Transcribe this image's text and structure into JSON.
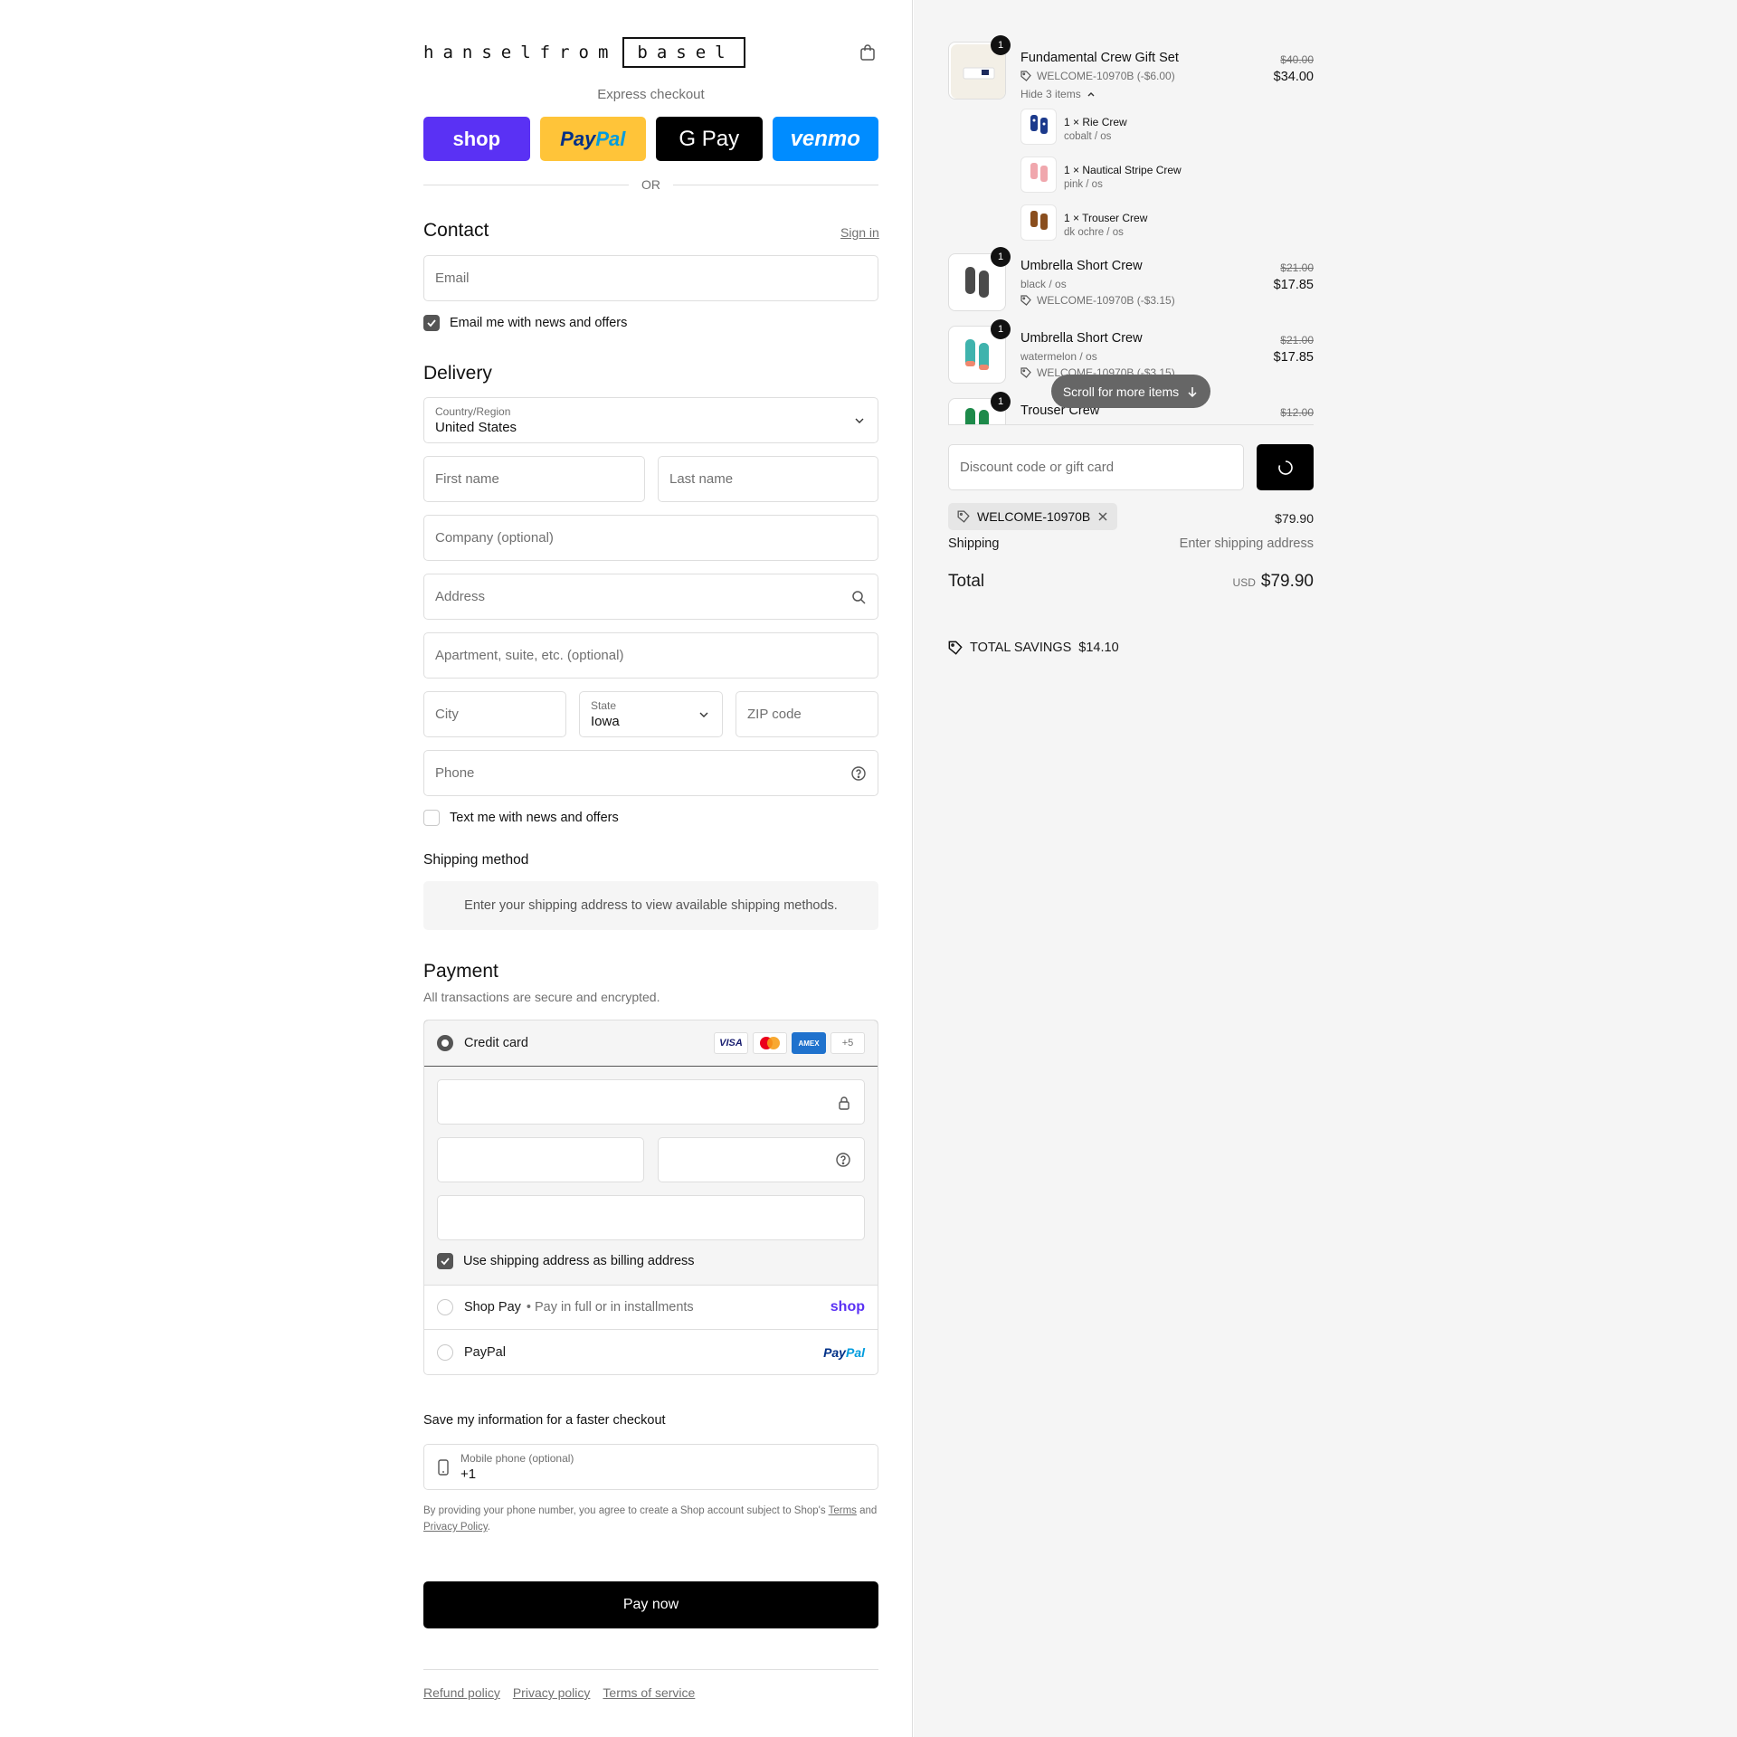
{
  "brand": {
    "left": "hanselfrom",
    "boxed": "basel"
  },
  "express": {
    "label": "Express checkout",
    "shop": "shop",
    "paypal_a": "Pay",
    "paypal_b": "Pal",
    "gpay": "G Pay",
    "venmo": "venmo",
    "or": "OR"
  },
  "contact": {
    "title": "Contact",
    "sign_in": "Sign in",
    "email_placeholder": "Email",
    "news_label": "Email me with news and offers"
  },
  "delivery": {
    "title": "Delivery",
    "country_label": "Country/Region",
    "country_value": "United States",
    "first_name": "First name",
    "last_name": "Last name",
    "company": "Company (optional)",
    "address": "Address",
    "apartment": "Apartment, suite, etc. (optional)",
    "city": "City",
    "state_label": "State",
    "state_value": "Iowa",
    "zip": "ZIP code",
    "phone": "Phone",
    "text_label": "Text me with news and offers"
  },
  "shipping_method": {
    "title": "Shipping method",
    "message": "Enter your shipping address to view available shipping methods."
  },
  "payment": {
    "title": "Payment",
    "subtitle": "All transactions are secure and encrypted.",
    "credit_card": "Credit card",
    "cards": [
      "VISA",
      "",
      "AMEX",
      "+5"
    ],
    "billing_label": "Use shipping address as billing address",
    "shop_pay": "Shop Pay",
    "shop_pay_sub": "• Pay in full or in installments",
    "shop_pay_brand": "shop",
    "paypal": "PayPal",
    "paypal_brand_a": "Pay",
    "paypal_brand_b": "Pal"
  },
  "save_info": {
    "title": "Save my information for a faster checkout",
    "mobile_label": "Mobile phone (optional)",
    "mobile_value": "+1",
    "legal_a": "By providing your phone number, you agree to create a Shop account subject to Shop's",
    "terms": "Terms",
    "legal_and": "and",
    "privacy": "Privacy Policy",
    "legal_end": "."
  },
  "pay_now": "Pay now",
  "footer": [
    "Refund policy",
    "Privacy policy",
    "Terms of service"
  ],
  "cart": {
    "items": [
      {
        "name": "Fundamental Crew Gift Set",
        "discount": "WELCOME-10970B (-$6.00)",
        "old_price": "$40.00",
        "price": "$34.00",
        "qty": "1",
        "toggle": "Hide 3 items",
        "sub_items": [
          {
            "qty_name": "1 × Rie Crew",
            "variant": "cobalt / os"
          },
          {
            "qty_name": "1 × Nautical Stripe Crew",
            "variant": "pink / os"
          },
          {
            "qty_name": "1 × Trouser Crew",
            "variant": "dk ochre / os"
          }
        ]
      },
      {
        "name": "Umbrella Short Crew",
        "variant": "black / os",
        "discount": "WELCOME-10970B (-$3.15)",
        "old_price": "$21.00",
        "price": "$17.85",
        "qty": "1"
      },
      {
        "name": "Umbrella Short Crew",
        "variant": "watermelon / os",
        "discount": "WELCOME-10970B (-$3.15)",
        "old_price": "$21.00",
        "price": "$17.85",
        "qty": "1"
      },
      {
        "name": "Trouser Crew",
        "old_price": "$12.00",
        "qty": "1"
      }
    ],
    "scroll_hint": "Scroll for more items",
    "discount_placeholder": "Discount code or gift card",
    "applied_code": "WELCOME-10970B",
    "subtotal": "$79.90",
    "shipping_label": "Shipping",
    "shipping_value": "Enter shipping address",
    "total_label": "Total",
    "currency": "USD",
    "total": "$79.90",
    "savings_label": "TOTAL SAVINGS",
    "savings_value": "$14.10"
  }
}
